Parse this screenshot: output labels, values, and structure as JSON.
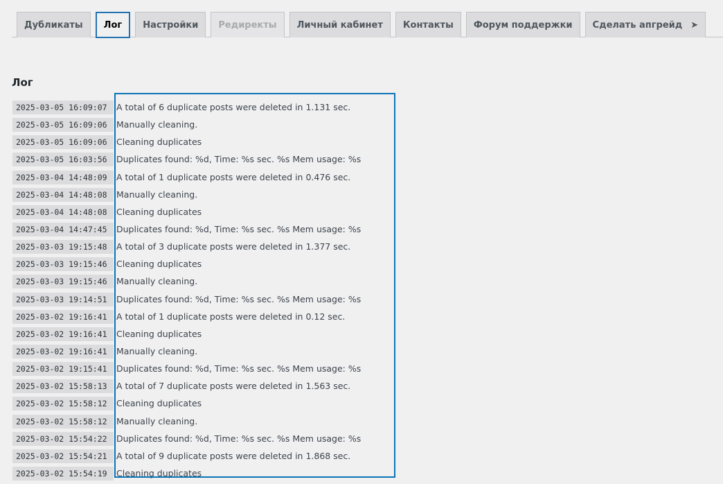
{
  "tabs": [
    {
      "label": "Дубликаты",
      "state": "normal"
    },
    {
      "label": "Лог",
      "state": "active"
    },
    {
      "label": "Настройки",
      "state": "normal"
    },
    {
      "label": "Редиректы",
      "state": "disabled"
    },
    {
      "label": "Личный кабинет",
      "state": "normal"
    },
    {
      "label": "Контакты",
      "state": "normal"
    },
    {
      "label": "Форум поддержки",
      "state": "normal"
    },
    {
      "label": "Сделать апгрейд",
      "state": "normal",
      "icon": "arrow-right-icon",
      "icon_glyph": "➤"
    }
  ],
  "title": "Лог",
  "log": [
    {
      "time": "2025-03-05 16:09:07",
      "message": "A total of 6 duplicate posts were deleted in 1.131 sec."
    },
    {
      "time": "2025-03-05 16:09:06",
      "message": "Manually cleaning."
    },
    {
      "time": "2025-03-05 16:09:06",
      "message": "Cleaning duplicates"
    },
    {
      "time": "2025-03-05 16:03:56",
      "message": "Duplicates found: %d, Time: %s sec. %s Mem usage: %s"
    },
    {
      "time": "2025-03-04 14:48:09",
      "message": "A total of 1 duplicate posts were deleted in 0.476 sec."
    },
    {
      "time": "2025-03-04 14:48:08",
      "message": "Manually cleaning."
    },
    {
      "time": "2025-03-04 14:48:08",
      "message": "Cleaning duplicates"
    },
    {
      "time": "2025-03-04 14:47:45",
      "message": "Duplicates found: %d, Time: %s sec. %s Mem usage: %s"
    },
    {
      "time": "2025-03-03 19:15:48",
      "message": "A total of 3 duplicate posts were deleted in 1.377 sec."
    },
    {
      "time": "2025-03-03 19:15:46",
      "message": "Cleaning duplicates"
    },
    {
      "time": "2025-03-03 19:15:46",
      "message": "Manually cleaning."
    },
    {
      "time": "2025-03-03 19:14:51",
      "message": "Duplicates found: %d, Time: %s sec. %s Mem usage: %s"
    },
    {
      "time": "2025-03-02 19:16:41",
      "message": "A total of 1 duplicate posts were deleted in 0.12 sec."
    },
    {
      "time": "2025-03-02 19:16:41",
      "message": "Cleaning duplicates"
    },
    {
      "time": "2025-03-02 19:16:41",
      "message": "Manually cleaning."
    },
    {
      "time": "2025-03-02 19:15:41",
      "message": "Duplicates found: %d, Time: %s sec. %s Mem usage: %s"
    },
    {
      "time": "2025-03-02 15:58:13",
      "message": "A total of 7 duplicate posts were deleted in 1.563 sec."
    },
    {
      "time": "2025-03-02 15:58:12",
      "message": "Cleaning duplicates"
    },
    {
      "time": "2025-03-02 15:58:12",
      "message": "Manually cleaning."
    },
    {
      "time": "2025-03-02 15:54:22",
      "message": "Duplicates found: %d, Time: %s sec. %s Mem usage: %s"
    },
    {
      "time": "2025-03-02 15:54:21",
      "message": "A total of 9 duplicate posts were deleted in 1.868 sec."
    },
    {
      "time": "2025-03-02 15:54:19",
      "message": "Cleaning duplicates"
    }
  ]
}
